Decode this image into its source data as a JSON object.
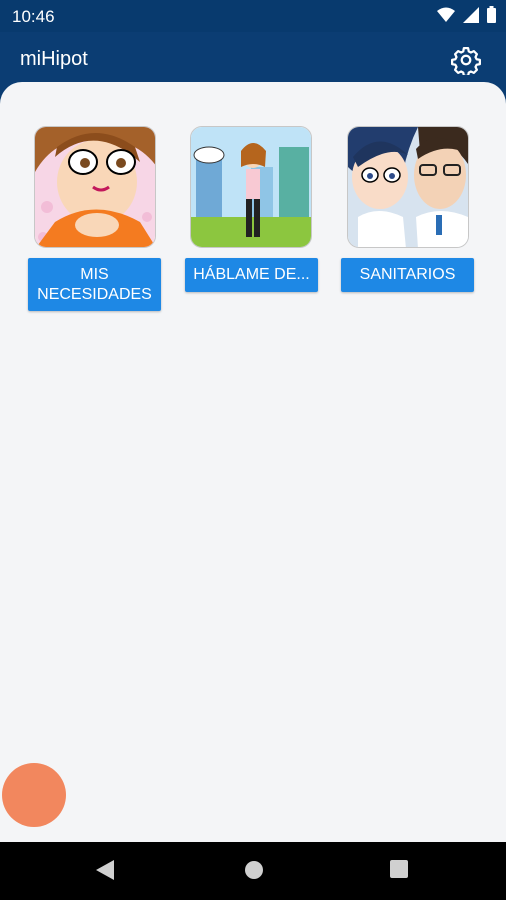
{
  "status": {
    "time": "10:46"
  },
  "app_bar": {
    "title": "miHipot"
  },
  "tiles": [
    {
      "label": "MIS\nNECESIDADES"
    },
    {
      "label": "HÁBLAME DE..."
    },
    {
      "label": "SANITARIOS"
    }
  ],
  "colors": {
    "primary": "#0b3d73",
    "button": "#1e88e5",
    "fab": "#f2875e",
    "background": "#f4f5f7"
  },
  "icons": {
    "settings": "gear-icon",
    "back": "back-triangle-icon",
    "home": "home-circle-icon",
    "recent": "recent-square-icon"
  }
}
